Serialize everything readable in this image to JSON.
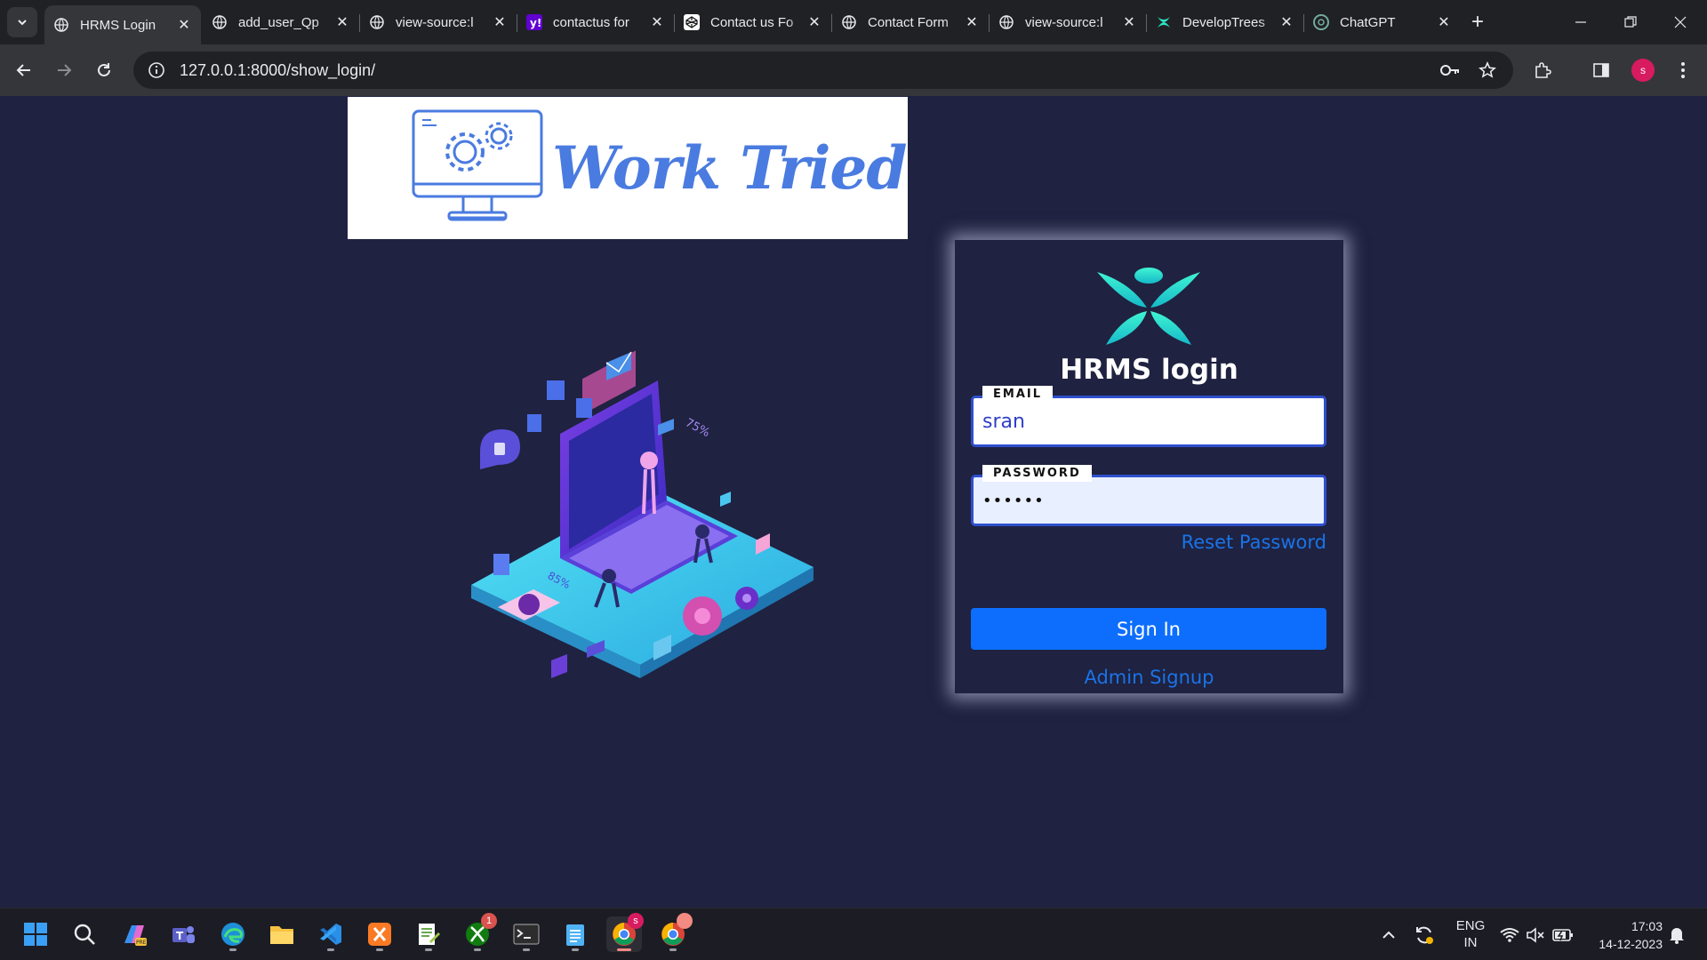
{
  "browser": {
    "tabs": [
      {
        "title": "HRMS Login",
        "icon": "globe-icon",
        "active": true
      },
      {
        "title": "add_user_Qp",
        "icon": "globe-icon"
      },
      {
        "title": "view-source:l",
        "icon": "globe-icon"
      },
      {
        "title": "contactus for",
        "icon": "yahoo-icon"
      },
      {
        "title": "Contact us Fo",
        "icon": "codepen-icon"
      },
      {
        "title": "Contact Form",
        "icon": "globe-icon"
      },
      {
        "title": "view-source:l",
        "icon": "globe-icon"
      },
      {
        "title": "DevelopTrees",
        "icon": "developtrees-icon"
      },
      {
        "title": "ChatGPT",
        "icon": "chatgpt-icon"
      }
    ],
    "url": "127.0.0.1:8000/show_login/",
    "profile_initial": "s"
  },
  "page": {
    "brand_name": "Work Tried",
    "login": {
      "title": "HRMS login",
      "email_label": "EMAIL",
      "email_value": "sran",
      "password_label": "PASSWORD",
      "password_value": "••••••",
      "reset_link": "Reset Password",
      "signin_button": "Sign In",
      "admin_signup_link": "Admin Signup"
    },
    "illustration_labels": {
      "percent_a": "75%",
      "percent_b": "85%"
    }
  },
  "taskbar": {
    "apps": [
      "start-icon",
      "search-icon",
      "copilot-icon",
      "teams-icon",
      "edge-icon",
      "file-explorer-icon",
      "vscode-icon",
      "xampp-icon",
      "notepad-plus-icon",
      "xbox-icon",
      "terminal-icon",
      "notepad-icon",
      "chrome-icon",
      "chrome-icon"
    ],
    "xbox_badge": "1",
    "language": "ENG",
    "region": "IN",
    "time": "17:03",
    "date": "14-12-2023"
  },
  "colors": {
    "page_bg": "#1f2240",
    "accent_blue": "#0d6efd",
    "link_blue": "#1a73e8",
    "logo_teal": "#2ee6c8",
    "brand_blue": "#4a7be0"
  }
}
